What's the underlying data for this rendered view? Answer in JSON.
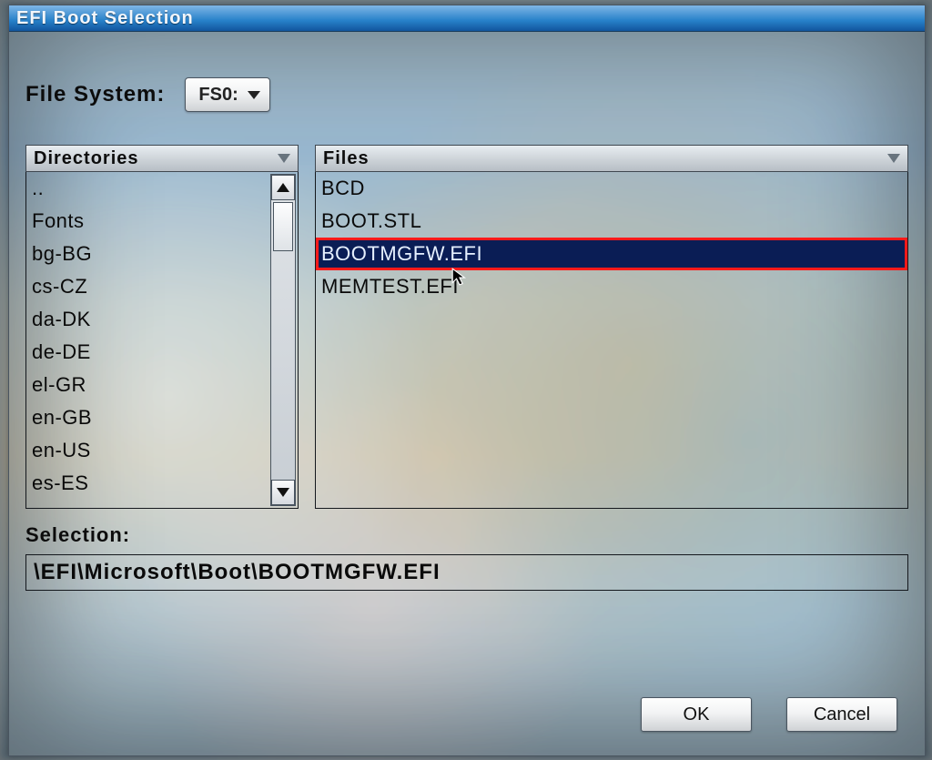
{
  "window": {
    "title": "EFI Boot Selection"
  },
  "file_system": {
    "label": "File System:",
    "selected": "FS0:"
  },
  "directories": {
    "header": "Directories",
    "items": [
      "..",
      "Fonts",
      "bg-BG",
      "cs-CZ",
      "da-DK",
      "de-DE",
      "el-GR",
      "en-GB",
      "en-US",
      "es-ES"
    ]
  },
  "files": {
    "header": "Files",
    "items": [
      "BCD",
      "BOOT.STL",
      "BOOTMGFW.EFI",
      "MEMTEST.EFI"
    ],
    "selected_index": 2
  },
  "selection": {
    "label": "Selection:",
    "path": "\\EFI\\Microsoft\\Boot\\BOOTMGFW.EFI"
  },
  "buttons": {
    "ok": "OK",
    "cancel": "Cancel"
  }
}
